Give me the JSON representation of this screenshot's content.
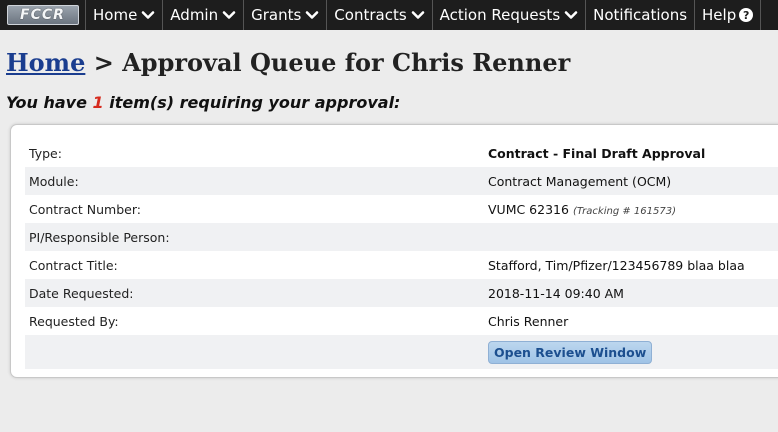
{
  "nav": {
    "logo_text": "FCCR",
    "items": [
      {
        "label": "Home",
        "has_dropdown": true
      },
      {
        "label": "Admin",
        "has_dropdown": true
      },
      {
        "label": "Grants",
        "has_dropdown": true
      },
      {
        "label": "Contracts",
        "has_dropdown": true
      },
      {
        "label": "Action Requests",
        "has_dropdown": true
      },
      {
        "label": "Notifications",
        "has_dropdown": false
      },
      {
        "label": "Help",
        "has_dropdown": false,
        "icon": "question-circle-icon"
      }
    ]
  },
  "header": {
    "breadcrumb_home": "Home",
    "breadcrumb_sep": ">",
    "title": "Approval Queue for Chris Renner"
  },
  "summary": {
    "prefix": "You have",
    "count": "1",
    "suffix": "item(s) requiring your approval:"
  },
  "item": {
    "rows": [
      {
        "label": "Type:",
        "value": "Contract - Final Draft Approval"
      },
      {
        "label": "Module:",
        "value": "Contract Management (OCM)"
      },
      {
        "label": "Contract Number:",
        "value": "VUMC 62316",
        "tracking": "(Tracking # 161573)"
      },
      {
        "label": "PI/Responsible Person:",
        "value": ""
      },
      {
        "label": "Contract Title:",
        "value": "Stafford, Tim/Pfizer/123456789 blaa blaa"
      },
      {
        "label": "Date Requested:",
        "value": "2018-11-14 09:40 AM"
      },
      {
        "label": "Requested By:",
        "value": "Chris Renner"
      }
    ],
    "action_label": "Open Review Window"
  },
  "colors": {
    "nav_bg": "#1d1d1d",
    "link": "#1a3d8f",
    "count": "#d62b1e",
    "button_bg": "#a9cbea"
  }
}
